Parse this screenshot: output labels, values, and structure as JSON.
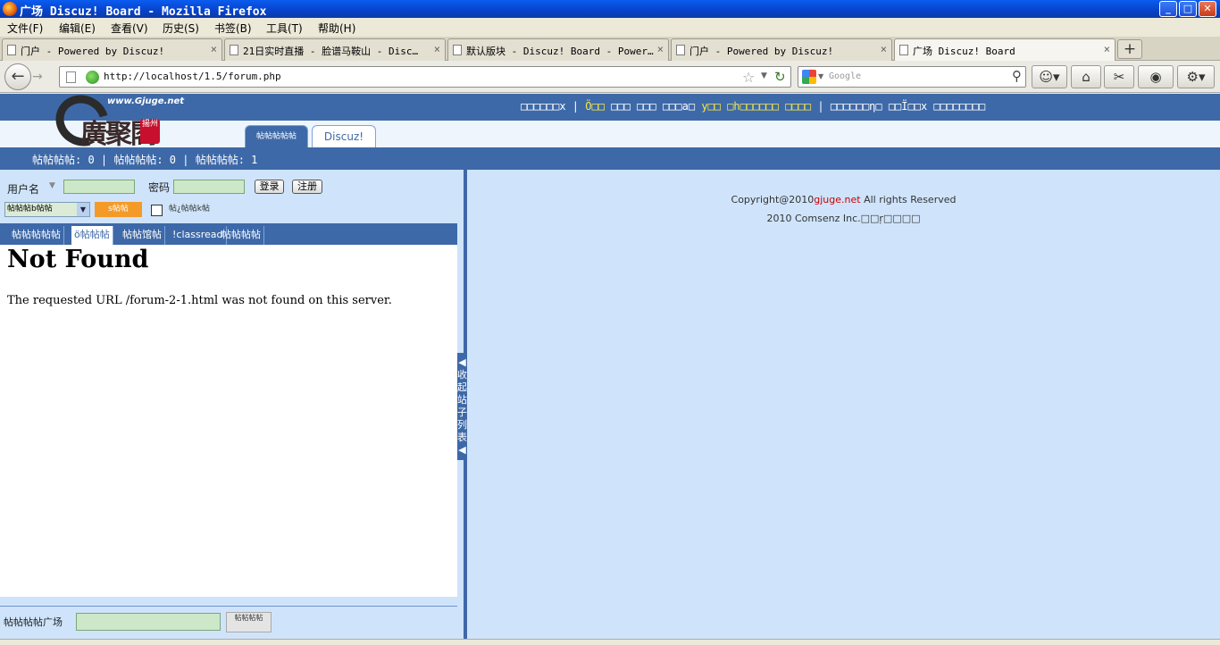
{
  "window": {
    "title": "广场 Discuz! Board - Mozilla Firefox",
    "controls": {
      "minimize": "_",
      "maximize": "□",
      "close": "✕"
    }
  },
  "menubar": [
    "文件(F)",
    "编辑(E)",
    "查看(V)",
    "历史(S)",
    "书签(B)",
    "工具(T)",
    "帮助(H)"
  ],
  "tabs": [
    {
      "label": "门户 - Powered by Discuz!"
    },
    {
      "label": "21日实时直播 - 脸谱马鞍山 - Disc…"
    },
    {
      "label": "默认版块 - Discuz! Board - Power…"
    },
    {
      "label": "门户 - Powered by Discuz!"
    },
    {
      "label": "广场 Discuz! Board"
    }
  ],
  "tab_close": "×",
  "new_tab": "+",
  "navbar": {
    "url": "http://localhost/1.5/forum.php",
    "search_placeholder": "Google"
  },
  "site": {
    "logo_url": "www.Gjuge.net",
    "logo_text": "廣聚閣",
    "logo_seal": "揚州",
    "topnav_a": "□□□□□□x | ",
    "topnav_b": "Ö□□",
    "topnav_c": " □□□ □□□ □□□a□ ",
    "topnav_d": "y□□ □h□□□□□□ □□□□",
    "topnav_e": " | □□□□□□η□ □□Ï□□x □□□□□□□□",
    "header_tab_active": "帖帖帖帖帖",
    "header_tab_normal": "Discuz!",
    "stats": "帖帖帖帖: 0 | 帖帖帖帖: 0 | 帖帖帖帖: 1"
  },
  "login": {
    "username_label": "用户名",
    "password_label": "密码",
    "login_button": "登录",
    "register_button": "注册",
    "select_value": "帖帖帖b帖帖",
    "orange_button": "s帖帖",
    "checkbox_label": "帖¿帖帖k帖"
  },
  "subtabs": [
    "帖帖帖帖帖",
    "ö帖帖帖",
    "帖帖馆帖",
    "!classread",
    "帖帖帖帖"
  ],
  "content": {
    "heading": "Not Found",
    "message": "The requested URL /forum-2-1.html was not found on this server."
  },
  "bottom": {
    "label": "帖帖帖帖广场",
    "button": "帖帖帖帖"
  },
  "divider_label": "收起站子列表",
  "footer": {
    "copyright_prefix": "Copyright@2010",
    "copyright_link": "gjuge.net",
    "copyright_suffix": " All rights Reserved",
    "line2": "2010 Comsenz Inc.□□ŗ□□□□"
  }
}
